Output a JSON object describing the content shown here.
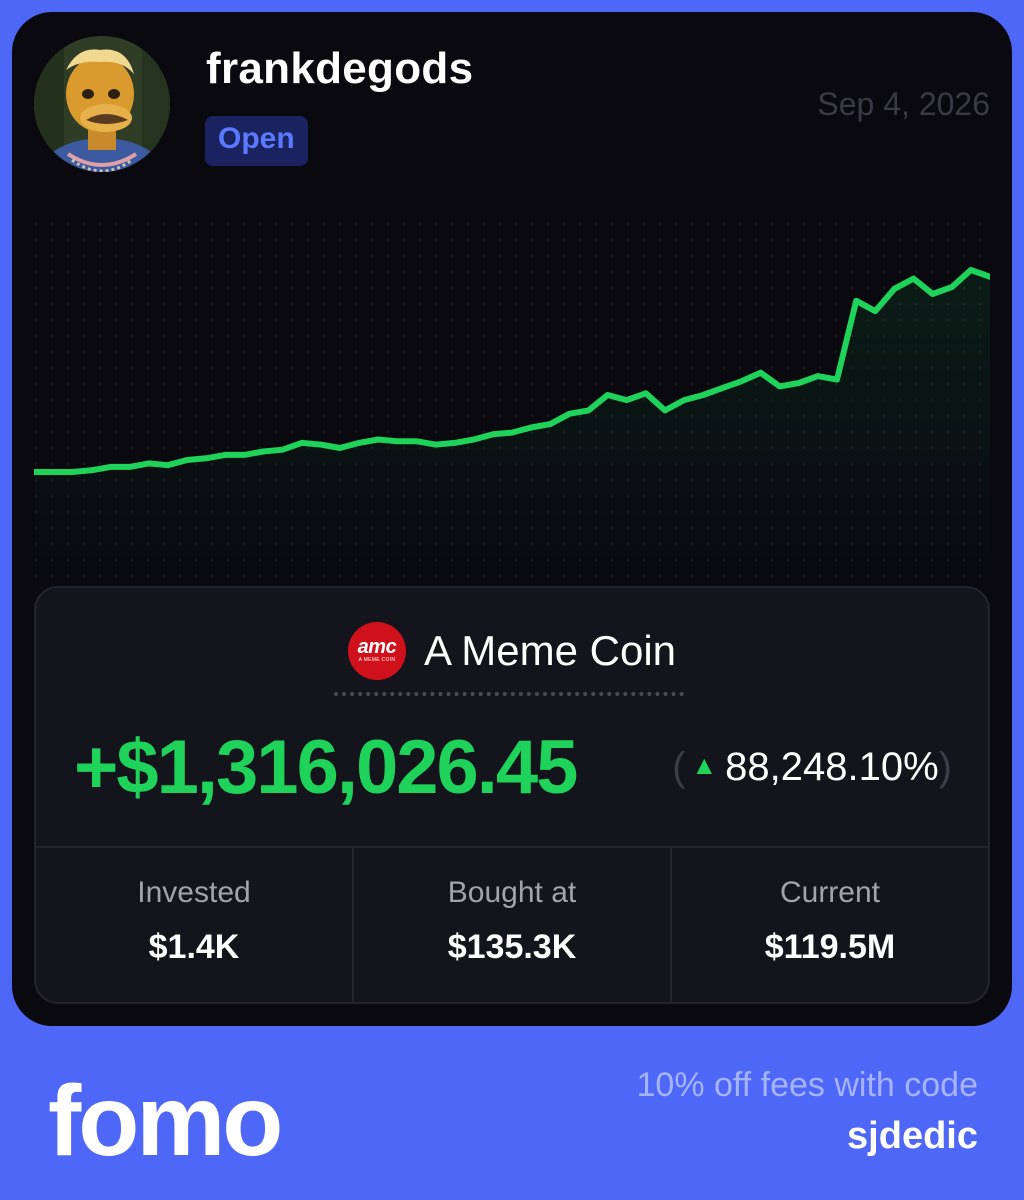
{
  "profile": {
    "username": "frankdegods",
    "status": "Open",
    "date": "Sep 4, 2026",
    "avatar_icon": "ape-avatar-icon"
  },
  "coin": {
    "name": "A Meme Coin",
    "logo_text": "amc",
    "logo_subtext": "A MEME COIN",
    "logo_color": "#d0101a"
  },
  "pnl": {
    "amount": "+$1,316,026.45",
    "percent": "88,248.10%",
    "color": "#1ed25a"
  },
  "stats": [
    {
      "label": "Invested",
      "value": "$1.4K"
    },
    {
      "label": "Bought at",
      "value": "$135.3K"
    },
    {
      "label": "Current",
      "value": "$119.5M"
    }
  ],
  "footer": {
    "brand": "fomo",
    "promo": "10% off fees with code",
    "code": "sjdedic",
    "background": "#4f67f7"
  },
  "chart_data": {
    "type": "line",
    "color": "#1ed25a",
    "values": [
      1.0,
      1.0,
      1.0,
      1.1,
      1.3,
      1.3,
      1.5,
      1.4,
      1.7,
      1.8,
      2.0,
      2.0,
      2.2,
      2.3,
      2.7,
      2.6,
      2.4,
      2.7,
      2.9,
      2.8,
      2.8,
      2.6,
      2.7,
      2.9,
      3.2,
      3.3,
      3.6,
      3.8,
      4.4,
      4.6,
      5.5,
      5.2,
      5.6,
      4.6,
      5.2,
      5.5,
      5.9,
      6.3,
      6.8,
      6.0,
      6.2,
      6.6,
      6.4,
      11.0,
      10.4,
      11.7,
      12.3,
      11.4,
      11.8,
      12.8,
      12.4
    ]
  }
}
